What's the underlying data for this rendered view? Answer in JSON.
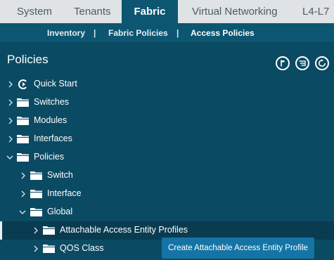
{
  "top_tabs": [
    "System",
    "Tenants",
    "Fabric",
    "Virtual Networking",
    "L4-L7"
  ],
  "sub_nav": {
    "items": [
      "Inventory",
      "Fabric Policies",
      "Access Policies"
    ],
    "separator": "|"
  },
  "panel": {
    "title": "Policies",
    "tools": [
      "flag-icon",
      "list-icon",
      "refresh-icon"
    ]
  },
  "tree": [
    {
      "label": "Quick Start",
      "icon": "quick-start-icon",
      "expanded": false
    },
    {
      "label": "Switches",
      "icon": "folder-icon",
      "expanded": false
    },
    {
      "label": "Modules",
      "icon": "folder-icon",
      "expanded": false
    },
    {
      "label": "Interfaces",
      "icon": "folder-icon",
      "expanded": false
    },
    {
      "label": "Policies",
      "icon": "folder-icon",
      "expanded": true
    },
    {
      "label": "Switch",
      "icon": "folder-icon",
      "expanded": false
    },
    {
      "label": "Interface",
      "icon": "folder-icon",
      "expanded": false
    },
    {
      "label": "Global",
      "icon": "folder-icon",
      "expanded": true
    },
    {
      "label": "Attachable Access Entity Profiles",
      "icon": "folder-icon",
      "expanded": false,
      "selected": true
    },
    {
      "label": "QOS Class",
      "icon": "folder-icon",
      "expanded": false
    }
  ],
  "tooltip": "Create Attachable Access Entity Profile",
  "colors": {
    "background": "#0b4a63",
    "tab_bar": "#dfe3e6",
    "active_tab": "#0c5672",
    "selected_row": "#093c51",
    "tooltip": "#1474a6"
  }
}
